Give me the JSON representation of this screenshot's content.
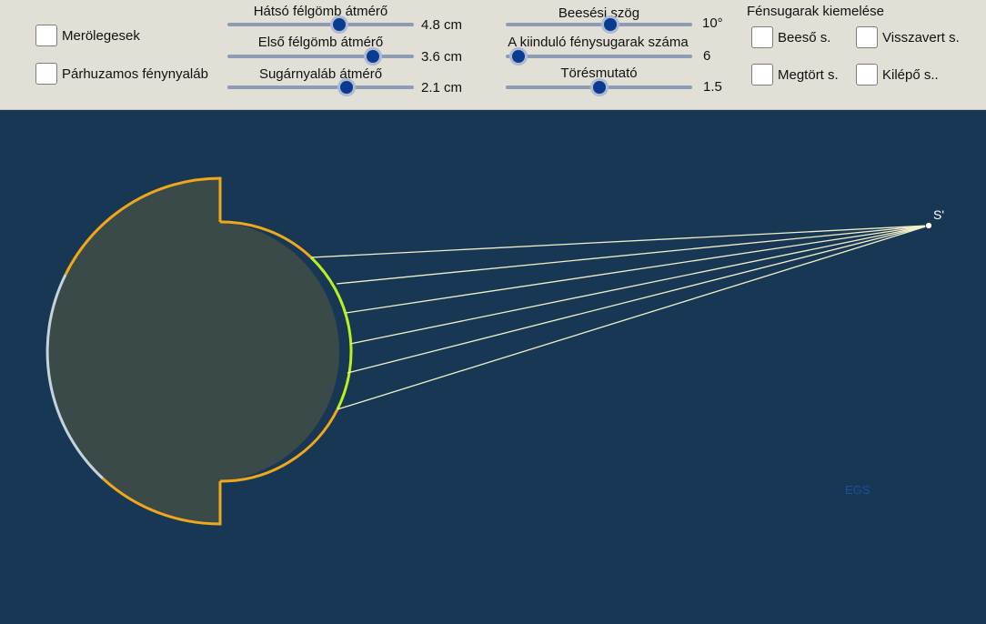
{
  "checkboxes": {
    "merolegesek": "Merölegesek",
    "parhuzamos": "Párhuzamos fénynyaláb",
    "beeso": "Beeső s.",
    "visszavert": "Visszavert s.",
    "megtort": "Megtört s.",
    "kilepo": "Kilépő s.."
  },
  "sliders": {
    "hatso": {
      "label": "Hátsó félgömb átmérő",
      "value": "4.8 cm",
      "fraction": 0.6
    },
    "elso": {
      "label": "Első félgömb átmérő",
      "value": "3.6 cm",
      "fraction": 0.78
    },
    "sugarnyalab": {
      "label": "Sugárnyaláb átmérő",
      "value": "2.1 cm",
      "fraction": 0.64
    },
    "beesesi": {
      "label": "Beesési szög",
      "value": "10°",
      "fraction": 0.56
    },
    "kiindulo": {
      "label": "A kiinduló fénysugarak száma",
      "value": "6",
      "fraction": 0.07
    },
    "toresmutato": {
      "label": "Törésmutató",
      "value": "1.5",
      "fraction": 0.5
    }
  },
  "section_title": "Fénsugarak kiemelése",
  "point_label": "S'",
  "corner_logo": "EGS",
  "colors": {
    "background": "#173755",
    "toolbar": "#e2dfd6",
    "body_fill": "#3a4a48",
    "outline": "#f0a81a",
    "reflective_arc": "#c5d3de",
    "highlight_arc": "#b8f11f",
    "rays": "#f3f0c8"
  }
}
